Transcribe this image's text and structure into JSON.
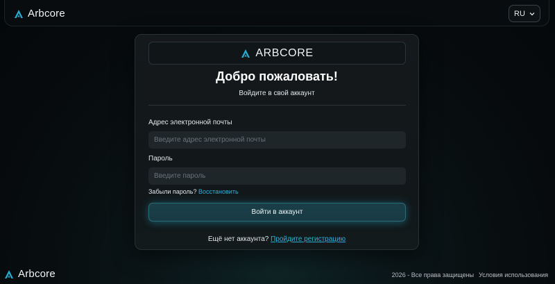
{
  "header": {
    "brand_name": "Arbcore",
    "brand_icon": "arbcore-logo-icon",
    "language": "RU",
    "language_icon": "chevron-down-icon"
  },
  "card": {
    "logo_text": "ARBCORE",
    "title": "Добро пожаловать!",
    "subtitle": "Войдите в свой аккаунт",
    "email": {
      "label": "Адрес электронной почты",
      "placeholder": "Введите адрес электронной почты",
      "value": ""
    },
    "password": {
      "label": "Пароль",
      "placeholder": "Введите пароль",
      "value": ""
    },
    "forgot_text": "Забыли пароль?",
    "forgot_link": "Восстановить",
    "login_button": "Войти в аккаунт",
    "register_text": "Ещё нет аккаунта?",
    "register_link": "Пройдите регистрацию"
  },
  "footer": {
    "brand_name": "Arbcore",
    "copyright": "2026 - Все права защищены",
    "terms_link": "Условия использования"
  },
  "colors": {
    "accent": "#2fb0d8",
    "logo_accent": "#2aa9cf",
    "background": "#070b0d",
    "card": "#15191c",
    "input": "#1f2629"
  }
}
